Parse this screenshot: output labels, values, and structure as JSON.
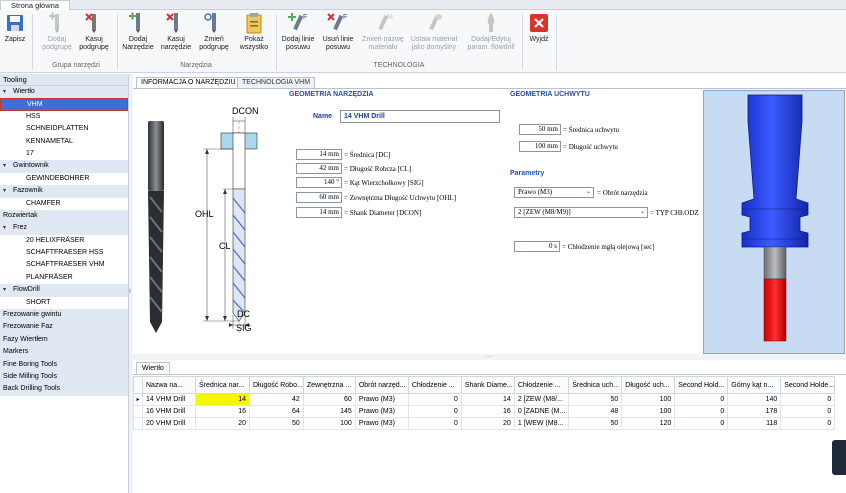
{
  "ribbon": {
    "tab": "Strona główna",
    "buttons": {
      "save": "Zapisz",
      "add_subgroup": "Dodaj podgrupę",
      "delete_subgroup": "Kasuj podgrupę",
      "add_tool": "Dodaj Narzędzie",
      "delete_tool": "Kasuj narzędzie",
      "change_subgroup": "Zmień podgrupę",
      "show_all": "Pokaż wszystko",
      "add_offset_line": "Dodaj linie posuwu",
      "delete_offset_line": "Usuń linie posuwu",
      "change_material_name": "Zmień nazwę materiału",
      "set_default_material": "Ustaw materiał jako domyślny",
      "add_edit_flowdrill": "Dodaj/Edytuj param. flowdrill",
      "exit": "Wyjdź"
    },
    "groups": {
      "tool_group": "Grupa narzędzi",
      "tools": "Narzędzia",
      "technology": "TECHNOLOGIA"
    }
  },
  "tree": {
    "title": "Tooling",
    "nodes": [
      {
        "label": "Wiertło",
        "kind": "group",
        "toggle": "▾"
      },
      {
        "label": "VHM",
        "kind": "child",
        "selected": true
      },
      {
        "label": "HSS",
        "kind": "child"
      },
      {
        "label": "SCHNEIDPLATTEN",
        "kind": "child"
      },
      {
        "label": "KENNAMETAL",
        "kind": "child"
      },
      {
        "label": "17",
        "kind": "child"
      },
      {
        "label": "Gwintownik",
        "kind": "group",
        "toggle": "▾"
      },
      {
        "label": "GEWINDEBOHRER",
        "kind": "child"
      },
      {
        "label": "Fazownik",
        "kind": "group",
        "toggle": "▾"
      },
      {
        "label": "CHAMFER",
        "kind": "child"
      },
      {
        "label": "Rozwiertak",
        "kind": "group"
      },
      {
        "label": "Frez",
        "kind": "group",
        "toggle": "▾"
      },
      {
        "label": "20 HELIXFRÄSER",
        "kind": "child"
      },
      {
        "label": "SCHAFTFRAESER HSS",
        "kind": "child"
      },
      {
        "label": "SCHAFTFRAESER VHM",
        "kind": "child"
      },
      {
        "label": "PLANFRÄSER",
        "kind": "child"
      },
      {
        "label": "FlowDrill",
        "kind": "group",
        "toggle": "▾"
      },
      {
        "label": "SHORT",
        "kind": "child"
      },
      {
        "label": "Frezowanie gwintu",
        "kind": "group"
      },
      {
        "label": "Frezowanie Faz",
        "kind": "group"
      },
      {
        "label": "Fazy Wiertłem",
        "kind": "group"
      },
      {
        "label": "Markers",
        "kind": "group"
      },
      {
        "label": "Fine Boring Tools",
        "kind": "group"
      },
      {
        "label": "Side Milling Tools",
        "kind": "group"
      },
      {
        "label": "Back Drilling Tools",
        "kind": "group"
      }
    ]
  },
  "main_tabs": [
    "INFORMACJA O NARZĘDZIU",
    "TECHNOLOGIA VHM"
  ],
  "diagram": {
    "dcon": "DCON",
    "ohl": "OHL",
    "cl": "CL",
    "dc": "DC",
    "sig": "SIG"
  },
  "geometry": {
    "title": "GEOMETRIA NARZĘDZIA",
    "name_label": "Name",
    "name_value": "14 VHM Drill",
    "fields": [
      {
        "value": "14 mm",
        "label": "= Średnica [DC]"
      },
      {
        "value": "42 mm",
        "label": "= Długość Robcza [CL]"
      },
      {
        "value": "140 °",
        "label": "= Kąt Wierzchołkowy [SIG]"
      },
      {
        "value": "60 mm",
        "label": "= Zewnętrzna Długość Uchwytu [OHL]"
      },
      {
        "value": "14 mm",
        "label": "= Shank Diameter [DCON]"
      }
    ]
  },
  "holder": {
    "title": "GEOMETRIA UCHWYTU",
    "diameter_value": "50 mm",
    "diameter_label": "= Średnica uchwytu",
    "length_value": "100 mm",
    "length_label": "= Długość uchwytu"
  },
  "params": {
    "title": "Parametry",
    "rotation_value": "Prawo  (M3)",
    "rotation_label": "= Obrót narzędzia",
    "cooling_value": "2 [ZEW (M8/M9)]",
    "cooling_label": "= TYP CHŁODZ",
    "mist_value": "0 s",
    "mist_label": "= Chłodzenie mgłą olejową [sec]"
  },
  "bottom": {
    "tab": "Wiertło",
    "columns": [
      "Nazwa na...",
      "Średnica nar...",
      "Długość Robo...",
      "Zewnętrzna ...",
      "Obrót narzęd...",
      "Chłodzenie ...",
      "Shank Diame...",
      "Chłodzenie ...",
      "Średnica uch...",
      "Długość uch...",
      "Second Hold...",
      "Górny kąt n...",
      "Second Holde..."
    ],
    "rows": [
      {
        "indicator": "▸",
        "cells": [
          "14 VHM Drill",
          "14",
          "42",
          "60",
          "Prawo  (M3)",
          "0",
          "14",
          "2 [ZEW (M8/...",
          "50",
          "100",
          "0",
          "140",
          "0"
        ]
      },
      {
        "indicator": "",
        "cells": [
          "16 VHM Drill",
          "16",
          "64",
          "145",
          "Prawo  (M3)",
          "0",
          "16",
          "0 [ZADNE (M...",
          "48",
          "100",
          "0",
          "178",
          "0"
        ]
      },
      {
        "indicator": "",
        "cells": [
          "20 VHM Drill",
          "20",
          "50",
          "100",
          "Prawo  (M3)",
          "0",
          "20",
          "1 [WEW (M8...",
          "50",
          "120",
          "0",
          "118",
          "0"
        ]
      }
    ]
  },
  "colors": {
    "accent": "#1f4fb5",
    "selection": "#3e6fd8",
    "highlight": "#f6f600",
    "holder_blue": "#1e3fe0",
    "holder_red": "#ff1a1a",
    "preview_bg": "#c7dcf2"
  }
}
